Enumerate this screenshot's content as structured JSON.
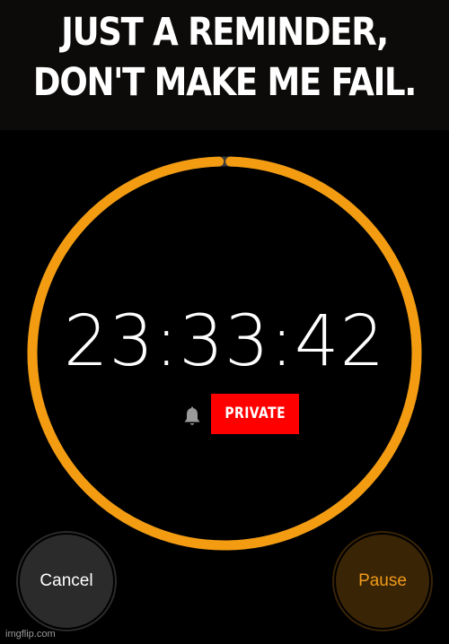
{
  "caption": {
    "line1": "JUST A REMINDER,",
    "line2": "DON'T MAKE ME FAIL."
  },
  "timer": {
    "time": "23:33:42",
    "progress_remaining": 0.99,
    "ring_color": "#f39c12",
    "ring_track_color": "#3a3a3a",
    "bell_icon": "bell-icon"
  },
  "badge": {
    "label": "PRIVATE",
    "color": "#ff0000"
  },
  "buttons": {
    "cancel_label": "Cancel",
    "pause_label": "Pause",
    "pause_text_color": "#f19b1a"
  },
  "watermark": {
    "text": "imgflip.com"
  }
}
